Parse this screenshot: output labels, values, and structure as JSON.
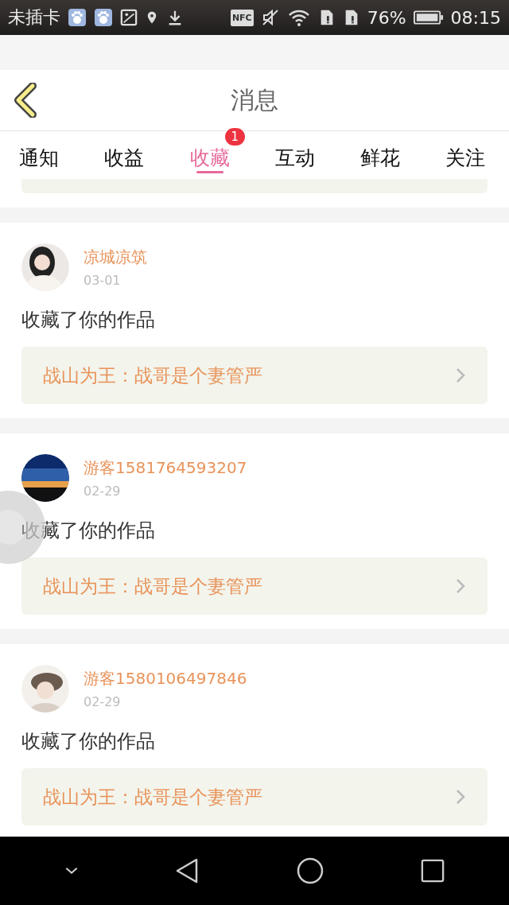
{
  "status_bar": {
    "carrier": "未插卡",
    "nfc": "NFC",
    "battery": "76%",
    "time": "08:15"
  },
  "header": {
    "title": "消息"
  },
  "tabs": [
    {
      "label": "通知",
      "selected": false
    },
    {
      "label": "收益",
      "selected": false
    },
    {
      "label": "收藏",
      "selected": true,
      "badge": "1"
    },
    {
      "label": "互动",
      "selected": false
    },
    {
      "label": "鲜花",
      "selected": false
    },
    {
      "label": "关注",
      "selected": false
    }
  ],
  "messages": [
    {
      "user": "凉城凉筑",
      "date": "03-01",
      "text": "收藏了你的作品",
      "work": "战山为王：战哥是个妻管严"
    },
    {
      "user": "游客1581764593207",
      "date": "02-29",
      "text": "收藏了你的作品",
      "work": "战山为王：战哥是个妻管严"
    },
    {
      "user": "游客1580106497846",
      "date": "02-29",
      "text": "收藏了你的作品",
      "work": "战山为王：战哥是个妻管严"
    }
  ]
}
